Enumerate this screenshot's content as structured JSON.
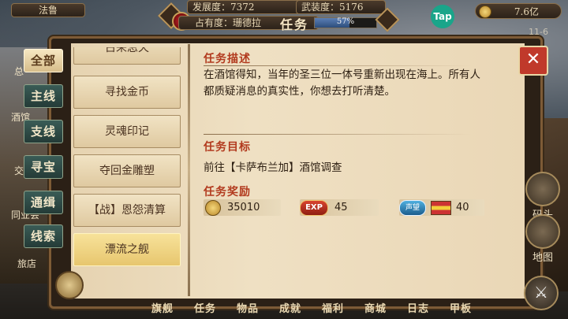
{
  "topbar": {
    "player_name": "法鲁",
    "development": "发展度：7372",
    "armament": "武装度：5176",
    "occupancy": "占有度：珊德拉",
    "mission_label": "任务",
    "progress_pct": 57,
    "progress_text": "57%",
    "tap_label": "Tap",
    "gold": "7.6亿",
    "date": "11-6"
  },
  "categories": [
    {
      "label": "全部",
      "active": true
    },
    {
      "label": "主线",
      "active": false
    },
    {
      "label": "支线",
      "active": false
    },
    {
      "label": "寻宝",
      "active": false
    },
    {
      "label": "通缉",
      "active": false
    },
    {
      "label": "线索",
      "active": false
    }
  ],
  "quests": [
    {
      "label": "古来忌天",
      "selected": false
    },
    {
      "label": "寻找金币",
      "selected": false
    },
    {
      "label": "灵魂印记",
      "selected": false
    },
    {
      "label": "夺回金雕塑",
      "selected": false
    },
    {
      "label": "【战】恩怨清算",
      "selected": false
    },
    {
      "label": "漂流之舰",
      "selected": true
    }
  ],
  "detail": {
    "description_title": "任务描述",
    "description": "在酒馆得知，当年的圣三位一体号重新出现在海上。所有人都质疑消息的真实性，你想去打听清楚。",
    "target_title": "任务目标",
    "target": "前往【卡萨布兰加】酒馆调查",
    "reward_title": "任务奖励",
    "rewards": {
      "gold": "35010",
      "exp_label": "EXP",
      "exp": "45",
      "fame_label": "声望",
      "fame": "40"
    }
  },
  "side_buttons": {
    "dock": "码头",
    "map": "地图"
  },
  "left_labels": {
    "a": "总",
    "b": "酒馆",
    "c": "交",
    "d": "同业会",
    "e": "旅店"
  },
  "bottom_nav": [
    "旗舰",
    "任务",
    "物品",
    "成就",
    "福利",
    "商城",
    "日志",
    "甲板"
  ],
  "icons": {
    "close": "close-icon",
    "gold": "gold-coin-icon",
    "compass": "compass-icon",
    "battle": "crossed-swords-icon"
  },
  "colors": {
    "accent_red": "#b23a1e",
    "close_red": "#c0392b",
    "tab_teal": "#3a5c56",
    "selected_gold": "#e7c66e"
  }
}
